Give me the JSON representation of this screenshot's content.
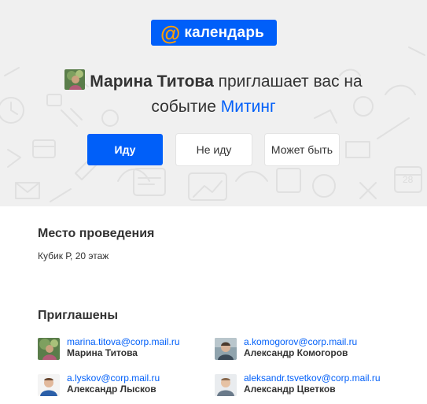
{
  "logo": {
    "at_symbol": "@",
    "brand": "календарь",
    "icon": "at-sign-icon"
  },
  "invite": {
    "host_name": "Марина Титова",
    "text": "приглашает вас на",
    "event_prefix": "событие",
    "event_name": "Митинг"
  },
  "actions": {
    "accept_label": "Иду",
    "decline_label": "Не иду",
    "maybe_label": "Может быть"
  },
  "location": {
    "title": "Место проведения",
    "value": "Кубик Р, 20 этаж"
  },
  "invitees": {
    "title": "Приглашены",
    "people": [
      {
        "email": "marina.titova@corp.mail.ru",
        "name": "Марина Титова"
      },
      {
        "email": "a.komogorov@corp.mail.ru",
        "name": "Александр Комогоров"
      },
      {
        "email": "a.lyskov@corp.mail.ru",
        "name": "Александр Лысков"
      },
      {
        "email": "aleksandr.tsvetkov@corp.mail.ru",
        "name": "Александр Цветков"
      }
    ]
  },
  "colors": {
    "accent": "#005ff9",
    "hero_bg": "#f0f0f0",
    "logo_at": "#ff9e00"
  }
}
